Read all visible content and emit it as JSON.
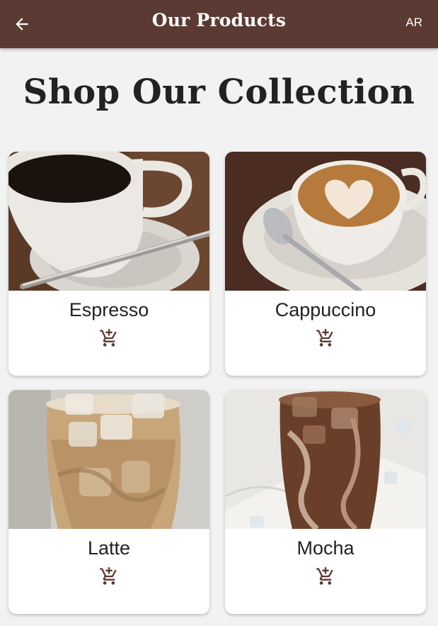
{
  "appbar": {
    "title": "Our Products",
    "back_icon": "arrow-left-icon",
    "language_label": "AR",
    "background_color": "#5b3a33"
  },
  "page": {
    "heading": "Shop Our Collection"
  },
  "products": [
    {
      "name": "Espresso",
      "image": "espresso-photo",
      "cart_icon": "add-shopping-cart-icon"
    },
    {
      "name": "Cappuccino",
      "image": "cappuccino-photo",
      "cart_icon": "add-shopping-cart-icon"
    },
    {
      "name": "Latte",
      "image": "iced-latte-photo",
      "cart_icon": "add-shopping-cart-icon"
    },
    {
      "name": "Mocha",
      "image": "iced-mocha-photo",
      "cart_icon": "add-shopping-cart-icon"
    }
  ],
  "colors": {
    "accent": "#5b3a33",
    "page_background": "#f2f2f2"
  }
}
